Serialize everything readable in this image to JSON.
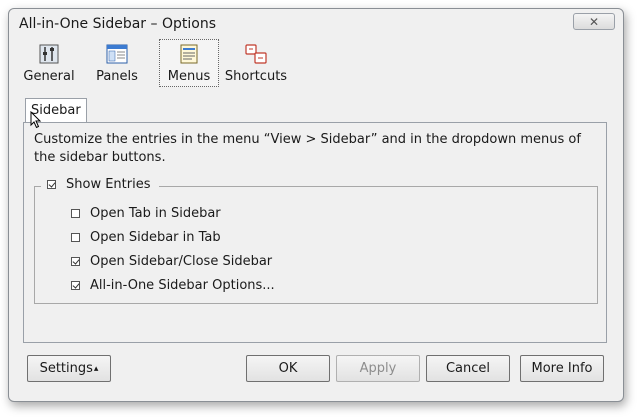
{
  "window": {
    "title": "All-in-One Sidebar – Options"
  },
  "titlebar": {
    "close_glyph": "✕"
  },
  "toolbar": {
    "items": [
      {
        "label": "General",
        "icon": "general-icon"
      },
      {
        "label": "Panels",
        "icon": "panels-icon"
      },
      {
        "label": "Menus",
        "icon": "menus-icon",
        "selected": true
      },
      {
        "label": "Shortcuts",
        "icon": "shortcuts-icon"
      }
    ]
  },
  "tabs": {
    "active": "Sidebar"
  },
  "panel": {
    "description": "Customize the entries in the menu “View > Sidebar” and in the dropdown menus of the sidebar buttons.",
    "group": {
      "label": "Show Entries",
      "checked": true,
      "entries": [
        {
          "label": "Open Tab in Sidebar",
          "checked": false
        },
        {
          "label": "Open Sidebar in Tab",
          "checked": false
        },
        {
          "label": "Open Sidebar/Close Sidebar",
          "checked": true
        },
        {
          "label": "All-in-One Sidebar Options...",
          "checked": true
        }
      ]
    }
  },
  "buttons": {
    "settings": "Settings",
    "settings_arrow": "▴",
    "ok": "OK",
    "apply": "Apply",
    "cancel": "Cancel",
    "more_info": "More Info"
  }
}
